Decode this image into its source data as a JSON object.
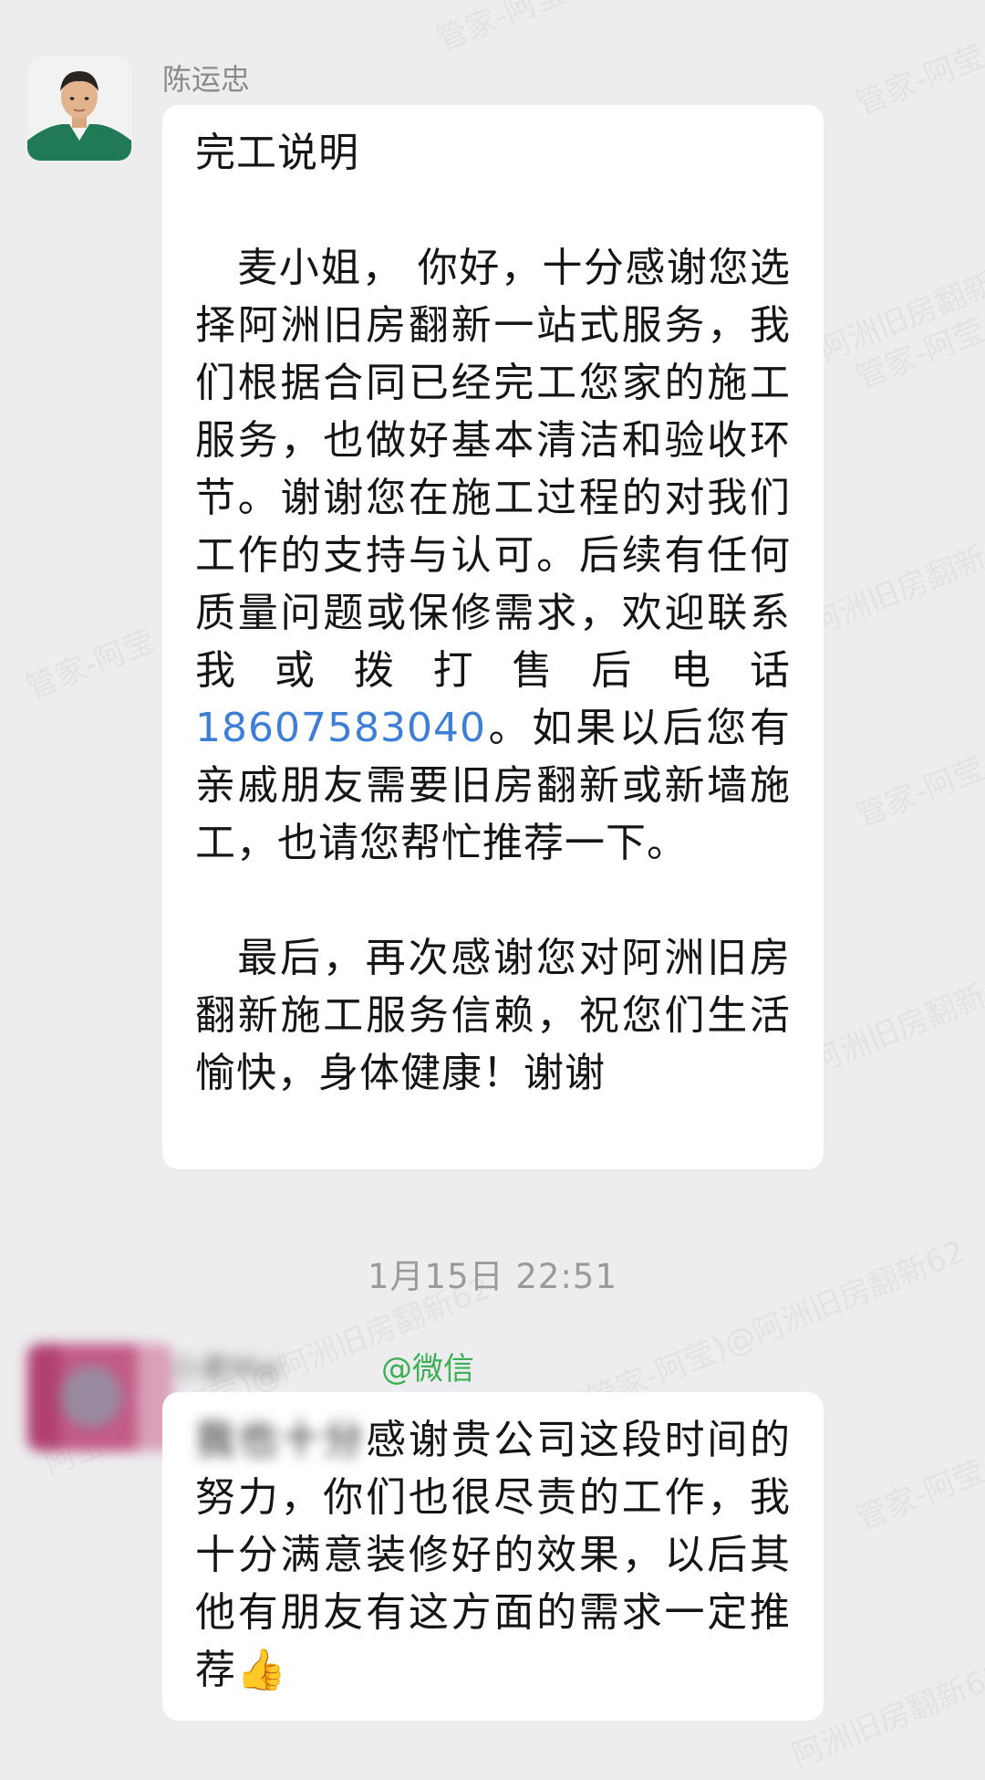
{
  "message1": {
    "sender_name": "陈运忠",
    "title": "完工说明",
    "para1_before_phone": "麦小姐， 你好，十分感谢您选择阿洲旧房翻新一站式服务，我们根据合同已经完工您家的施工服务，也做好基本清洁和验收环节。谢谢您在施工过程的对我们工作的支持与认可。后续有任何质量问题或保修需求，欢迎联系我或拨打售后电话",
    "phone": "18607583040",
    "para1_after_phone": "。如果以后您有亲戚朋友需要旧房翻新或新墙施工，也请您帮忙推荐一下。",
    "para2": "最后，再次感谢您对阿洲旧房翻新施工服务信赖，祝您们生活愉快，身体健康！谢谢"
  },
  "timestamp": "1月15日  22:51",
  "message2": {
    "sender_name_blurred": "小麦Mai",
    "source_tag": "@微信",
    "text_blurred": "我也十分",
    "text": "感谢贵公司这段时间的努力，你们也很尽责的工作，我十分满意装修好的效果，以后其他有朋友有这方面的需求一定推荐",
    "emoji": "👍"
  },
  "watermark": {
    "texts": [
      "阿莹(管家-阿莹)@阿洲旧房翻新62",
      "管家-阿莹",
      "阿洲旧房翻新62"
    ]
  },
  "colors": {
    "background": "#ededf0",
    "bubble": "#ffffff",
    "link": "#3d7fd6",
    "source_tag": "#3cb055"
  }
}
